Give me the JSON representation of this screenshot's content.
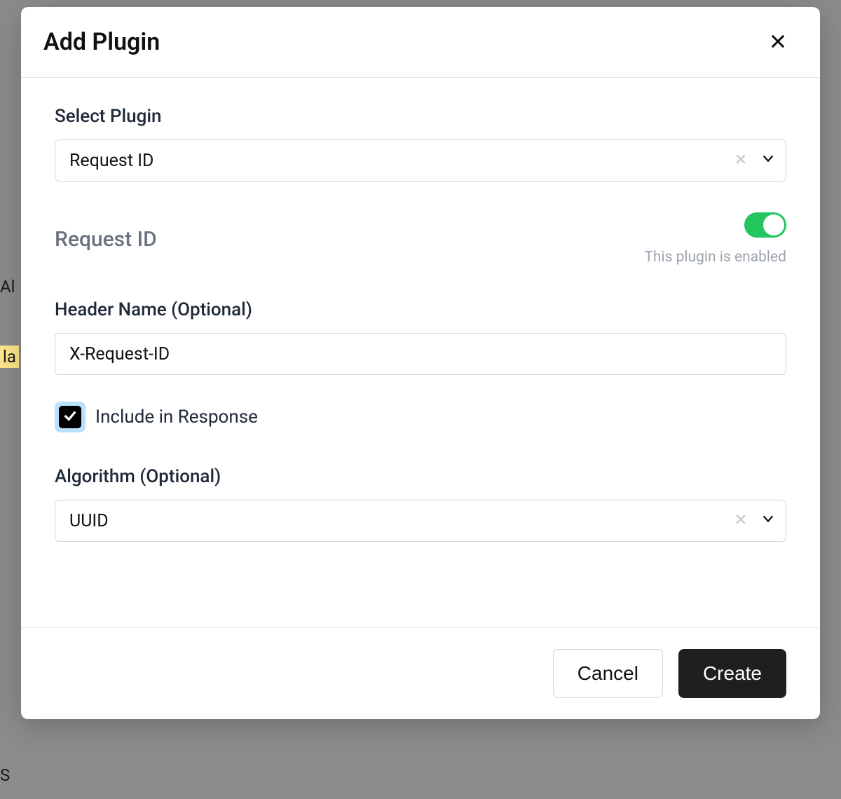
{
  "modal": {
    "title": "Add Plugin",
    "selectPlugin": {
      "label": "Select Plugin",
      "value": "Request ID"
    },
    "plugin": {
      "name": "Request ID",
      "enabled": true,
      "enabledHelp": "This plugin is enabled"
    },
    "headerName": {
      "label": "Header Name (Optional)",
      "value": "X-Request-ID"
    },
    "includeInResponse": {
      "label": "Include in Response",
      "checked": true
    },
    "algorithm": {
      "label": "Algorithm (Optional)",
      "value": "UUID"
    },
    "footer": {
      "cancel": "Cancel",
      "create": "Create"
    }
  },
  "background": {
    "fragment1": "Al",
    "fragment2": "la",
    "fragment3": "S"
  }
}
